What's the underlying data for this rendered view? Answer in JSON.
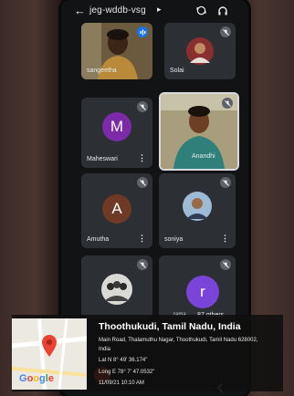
{
  "header": {
    "meeting_code": "jeg-wddb-vsg",
    "back_icon": "back-arrow-icon",
    "caret": "▸"
  },
  "participants": [
    {
      "name": "sangeetha",
      "video": "photo"
    },
    {
      "name": "Solai",
      "video": "photo"
    },
    {
      "name": "Maheswari",
      "initial": "M",
      "avatar_color": "#7b2aa8"
    },
    {
      "name": "Anandhi",
      "video": "photo"
    },
    {
      "name": "Amutha",
      "initial": "A",
      "avatar_color": "#6e3a26"
    },
    {
      "name": "soniya",
      "video": "photo"
    },
    {
      "name": "",
      "video": "photo"
    },
    {
      "name": "rama",
      "initial": "r",
      "avatar_color": "#7a44d8",
      "extra": "87 others"
    }
  ],
  "location": {
    "title": "Thoothukudi, Tamil Nadu, India",
    "address_line1": "Main Road, Thalamuthu Nagar, Thoothukudi, Tamil Nadu 628002,",
    "address_line2": "India",
    "lat": "Lat N 8° 49' 36.174\"",
    "long": "Long E 78° 7' 47.0532\"",
    "datetime": "11/09/21 10:10 AM",
    "map_logo": "Google"
  }
}
